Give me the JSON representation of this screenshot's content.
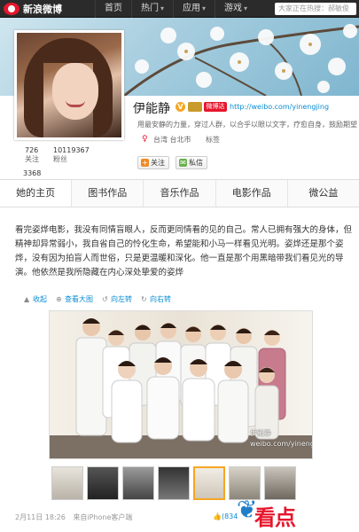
{
  "topbar": {
    "logo_text": "新浪微博",
    "nav": [
      {
        "label": "首页"
      },
      {
        "label": "热门",
        "caret": "▾"
      },
      {
        "label": "应用",
        "caret": "▾"
      },
      {
        "label": "游戏",
        "caret": "▾"
      }
    ],
    "search_placeholder": "大家正在热搜：郝敏俊"
  },
  "profile": {
    "name": "伊能静",
    "verified_icon": "V",
    "badge_red": "微博达人",
    "url": "http://weibo.com/yinengjing",
    "intro": "用最安静的力量，穿过人群，以合乎以眼以文字，疗愈自身，鼓励期望",
    "gender_icon": "♀",
    "location": "台湾 台北市",
    "tag": "标签",
    "follow_button": "关注",
    "message_button": "私信",
    "stats": {
      "following_count": "726",
      "following_label": "关注",
      "followers_count": "10119367",
      "followers_label": "粉丝",
      "weibo_count": "3368"
    }
  },
  "tabs": [
    {
      "label": "她的主页",
      "active": true
    },
    {
      "label": "图书作品"
    },
    {
      "label": "音乐作品"
    },
    {
      "label": "电影作品"
    },
    {
      "label": "微公益"
    }
  ],
  "post": {
    "text": "看完姿烨电影，我没有同情盲眼人，反而更同情看的见的自己。常人已拥有强大的身体，但精神却异常弱小，我自省自己的怜化生命，希望能和小马一样看见光明。姿烨还是那个姿烨，没有因为拍盲人而世俗，只是更温暖和深化。他一直是那个用黑暗带我们看见光的导演。他依然是我所隐藏在内心深处挚爱的姿烨",
    "actions": [
      {
        "label": "收起",
        "icon": "collapse-icon"
      },
      {
        "label": "查看大图",
        "icon": "zoom-icon"
      },
      {
        "label": "向左转",
        "icon": "rotate-left-icon"
      },
      {
        "label": "向右转",
        "icon": "rotate-right-icon"
      }
    ],
    "watermark_line1": "伊能静",
    "watermark_line2": "weibo.com/yinengjing",
    "thumb_count": 7,
    "selected_thumb": 5,
    "timestamp": "2月11日 18:26",
    "source": "来自iPhone客户端",
    "like_count": "(834"
  },
  "brand": {
    "text": "看点"
  },
  "colors": {
    "accent_red": "#e6162d",
    "link_blue": "#0a8cd2",
    "topbar": "#2b2b2b"
  }
}
